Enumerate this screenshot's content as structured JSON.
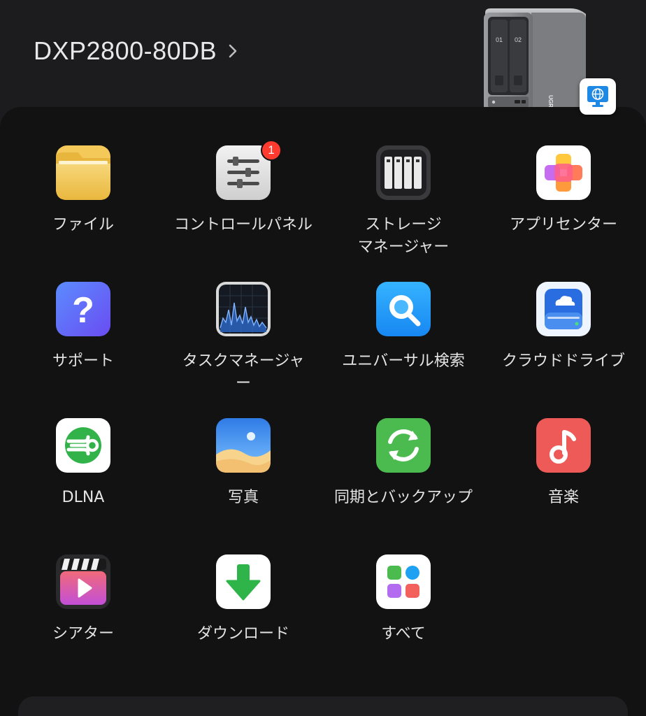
{
  "header": {
    "device_name": "DXP2800-80DB",
    "nas_image": {
      "bay_1": "01",
      "bay_2": "02",
      "brand": "UGREEN"
    },
    "remote_icon": "globe-monitor-icon"
  },
  "apps": [
    {
      "label": "ファイル",
      "icon": "folder-icon"
    },
    {
      "label": "コントロールパネル",
      "icon": "control-sliders-icon",
      "badge": "1"
    },
    {
      "label": "ストレージ\nマネージャー",
      "icon": "storage-drives-icon"
    },
    {
      "label": "アプリセンター",
      "icon": "app-center-icon"
    },
    {
      "label": "サポート",
      "icon": "question-icon"
    },
    {
      "label": "タスクマネージャ\nー",
      "icon": "activity-graph-icon"
    },
    {
      "label": "ユニバーサル検索",
      "icon": "search-icon"
    },
    {
      "label": "クラウドドライブ",
      "icon": "cloud-drive-icon"
    },
    {
      "label": "DLNA",
      "icon": "dlna-icon"
    },
    {
      "label": "写真",
      "icon": "photo-icon"
    },
    {
      "label": "同期とバックアップ",
      "icon": "sync-icon"
    },
    {
      "label": "音楽",
      "icon": "music-note-icon"
    },
    {
      "label": "シアター",
      "icon": "clapperboard-icon"
    },
    {
      "label": "ダウンロード",
      "icon": "download-arrow-icon"
    },
    {
      "label": "すべて",
      "icon": "all-apps-icon"
    }
  ],
  "colors": {
    "background": "#1c1c1e",
    "panel": "#121212",
    "badge": "#ff3b30"
  }
}
